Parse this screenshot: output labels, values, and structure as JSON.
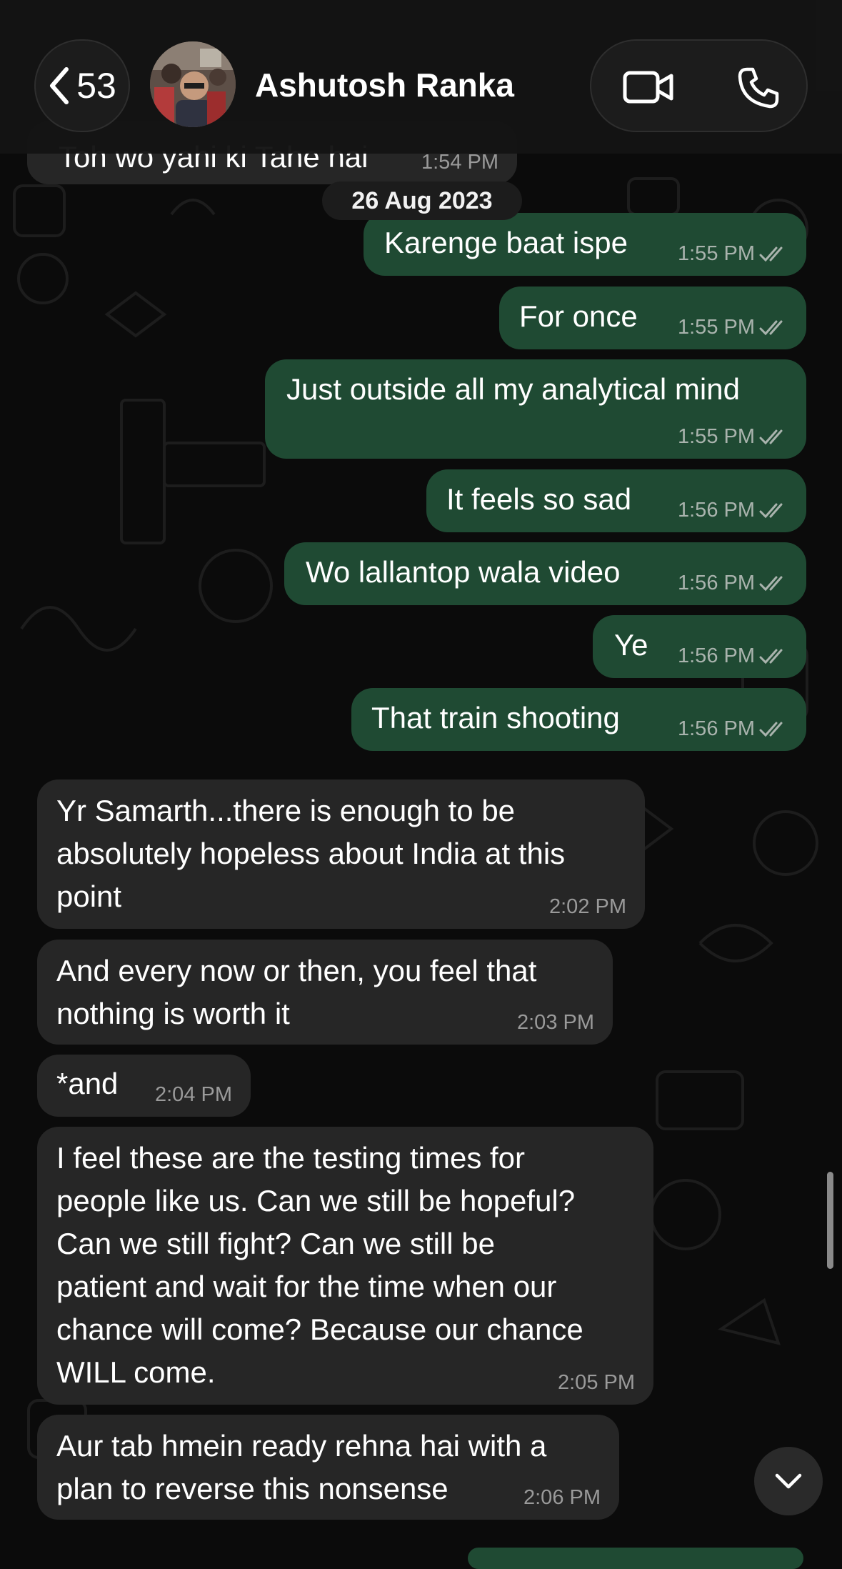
{
  "header": {
    "unread_count": "53",
    "contact_name": "Ashutosh Ranka",
    "icons": {
      "back": "chevron-left-icon",
      "video": "video-camera-icon",
      "call": "phone-icon"
    }
  },
  "date_separator": "26 Aug 2023",
  "messages": [
    {
      "dir": "in",
      "text": "Toh wo yahi ki Tahe hai",
      "time": "1:54 PM"
    },
    {
      "dir": "out",
      "text": "Karenge baat ispe",
      "time": "1:55 PM"
    },
    {
      "dir": "out",
      "text": "For once",
      "time": "1:55 PM"
    },
    {
      "dir": "out",
      "text": "Just outside all my analytical mind",
      "time": "1:55 PM"
    },
    {
      "dir": "out",
      "text": "It feels so sad",
      "time": "1:56 PM"
    },
    {
      "dir": "out",
      "text": "Wo lallantop wala video",
      "time": "1:56 PM"
    },
    {
      "dir": "out",
      "text": "Ye",
      "time": "1:56 PM"
    },
    {
      "dir": "out",
      "text": "That train shooting",
      "time": "1:56 PM"
    },
    {
      "dir": "in",
      "text": "Yr Samarth...there is enough to be\nabsolutely hopeless about India at this\npoint",
      "time": "2:02 PM"
    },
    {
      "dir": "in",
      "text": "And every now or then, you feel that\nnothing is worth it",
      "time": "2:03 PM"
    },
    {
      "dir": "in",
      "text": "*and",
      "time": "2:04 PM"
    },
    {
      "dir": "in",
      "text": "I feel these are the testing times for\npeople like us. Can we still be hopeful?\nCan we still fight? Can we still be\npatient and wait for the time when our\nchance will come? Because our chance\nWILL come.",
      "time": "2:05 PM"
    },
    {
      "dir": "in",
      "text": "Aur tab hmein ready rehna hai with a\nplan to reverse this nonsense",
      "time": "2:06 PM"
    }
  ],
  "colors": {
    "outgoing_bubble": "#1f4a33",
    "incoming_bubble": "#262626",
    "read_ticks": "#a9b3ad",
    "background": "#0b0b0b"
  }
}
